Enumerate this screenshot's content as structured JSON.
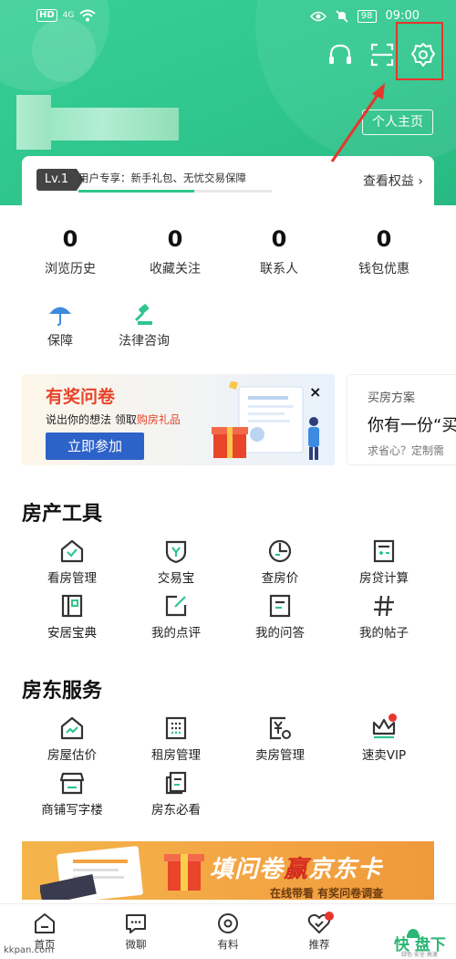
{
  "status": {
    "hd": "HD",
    "net": "4G",
    "battery": "98",
    "time": "09:00"
  },
  "header": {
    "profile_button": "个人主页",
    "level": "Lv.1",
    "level_text": "用户专享：新手礼包、无忧交易保障",
    "level_progress": 0.6,
    "rights_link": "查看权益 ›"
  },
  "stats": [
    {
      "value": "0",
      "label": "浏览历史"
    },
    {
      "value": "0",
      "label": "收藏关注"
    },
    {
      "value": "0",
      "label": "联系人"
    },
    {
      "value": "0",
      "label": "钱包优惠"
    }
  ],
  "quick": [
    {
      "label": "保障",
      "icon": "umbrella-icon"
    },
    {
      "label": "法律咨询",
      "icon": "gavel-icon"
    }
  ],
  "banner1": {
    "title": "有奖问卷",
    "sub_a": "说出你的想法 领取",
    "sub_b": "购房礼品",
    "button": "立即参加",
    "close": "×"
  },
  "banner2": {
    "tag": "买房方案",
    "heading": "你有一份“买",
    "sub": "求省心？定制需"
  },
  "tools": {
    "title": "房产工具",
    "items": [
      {
        "label": "看房管理",
        "icon": "house-check-icon"
      },
      {
        "label": "交易宝",
        "icon": "shield-y-icon"
      },
      {
        "label": "查房价",
        "icon": "pie-chart-icon"
      },
      {
        "label": "房贷计算",
        "icon": "calculator-icon"
      },
      {
        "label": "安居宝典",
        "icon": "book-icon"
      },
      {
        "label": "我的点评",
        "icon": "edit-icon"
      },
      {
        "label": "我的问答",
        "icon": "qa-icon"
      },
      {
        "label": "我的帖子",
        "icon": "hash-icon"
      }
    ]
  },
  "landlord": {
    "title": "房东服务",
    "items": [
      {
        "label": "房屋估价",
        "icon": "house-chart-icon"
      },
      {
        "label": "租房管理",
        "icon": "building-icon"
      },
      {
        "label": "卖房管理",
        "icon": "yuan-doc-icon"
      },
      {
        "label": "速卖VIP",
        "icon": "crown-icon"
      },
      {
        "label": "商铺写字楼",
        "icon": "shop-icon"
      },
      {
        "label": "房东必看",
        "icon": "note-icon"
      }
    ]
  },
  "banner3": {
    "title_a": "填问卷",
    "title_b": "赢",
    "title_c": "京东卡",
    "sub": "在线带看 有奖问卷调查"
  },
  "tabs": [
    {
      "label": "首页",
      "icon": "home-icon"
    },
    {
      "label": "微聊",
      "icon": "chat-icon"
    },
    {
      "label": "有料",
      "icon": "disc-icon"
    },
    {
      "label": "推荐",
      "icon": "heart-check-icon"
    }
  ],
  "watermark": "kkpan.com",
  "logo": {
    "text": "快 盘下载",
    "sub": "绿色·安全·高速"
  },
  "colors": {
    "brand": "#2fc68d",
    "accent_red": "#e8352b",
    "button_blue": "#2d62c8"
  }
}
